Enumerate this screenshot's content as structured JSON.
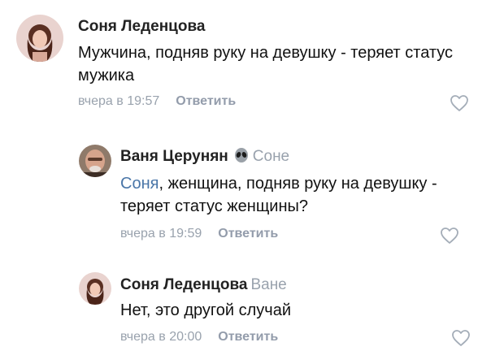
{
  "comments": [
    {
      "author": "Соня Леденцова",
      "reply_to": "",
      "text": "Мужчина, подняв руку на девушку - теряет статус мужика",
      "time": "вчера в 19:57",
      "reply_label": "Ответить",
      "avatar": "avatar-girl",
      "like_icon": "heart-outline-icon"
    },
    {
      "author": "Ваня Церунян",
      "author_badge": "alien-emoji",
      "reply_to": "Соне",
      "mention": "Соня",
      "text": ", женщина, подняв руку на девушку - теряет статус женщины?",
      "time": "вчера в 19:59",
      "reply_label": "Ответить",
      "avatar": "avatar-old-man",
      "like_icon": "heart-outline-icon"
    },
    {
      "author": "Соня Леденцова",
      "reply_to": "Ване",
      "text": "Нет, это другой случай",
      "time": "вчера в 20:00",
      "reply_label": "Ответить",
      "avatar": "avatar-girl",
      "like_icon": "heart-outline-icon"
    }
  ],
  "colors": {
    "mention": "#4a76a8",
    "meta": "#99a2ad",
    "author": "#222222"
  }
}
